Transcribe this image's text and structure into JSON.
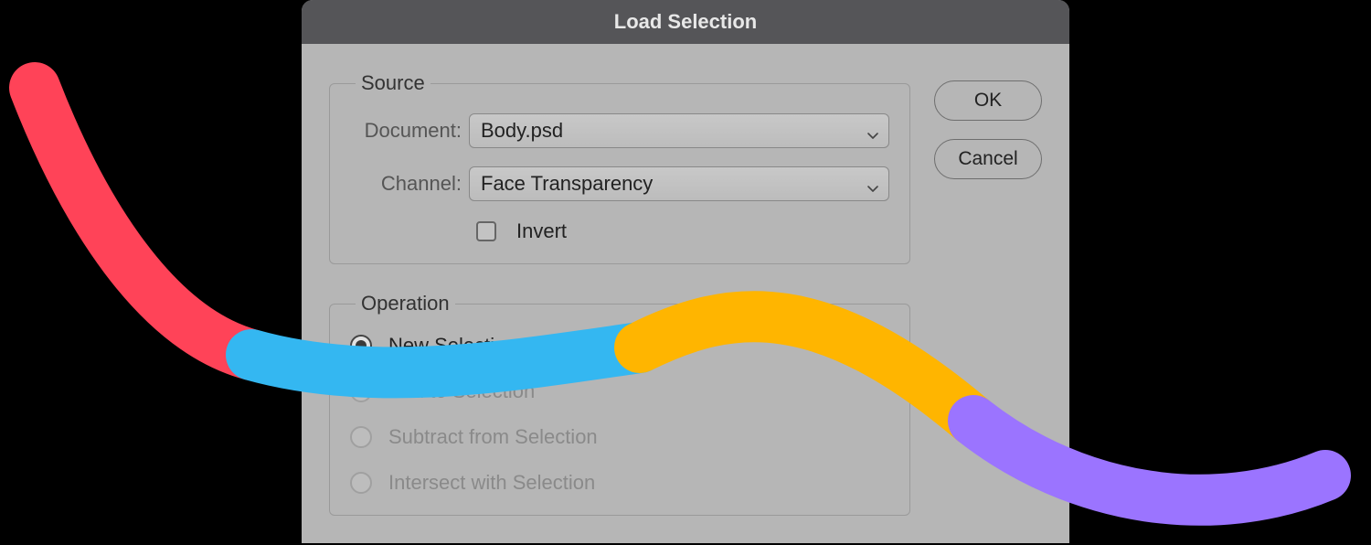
{
  "title": "Load Selection",
  "source": {
    "legend": "Source",
    "document_label": "Document:",
    "document_value": "Body.psd",
    "channel_label": "Channel:",
    "channel_value": "Face Transparency",
    "invert_label": "Invert",
    "invert_checked": false
  },
  "operation": {
    "legend": "Operation",
    "options": [
      {
        "label": "New Selection",
        "selected": true,
        "enabled": true
      },
      {
        "label": "Add to Selection",
        "selected": false,
        "enabled": false
      },
      {
        "label": "Subtract from Selection",
        "selected": false,
        "enabled": false
      },
      {
        "label": "Intersect with Selection",
        "selected": false,
        "enabled": false
      }
    ]
  },
  "buttons": {
    "ok": "OK",
    "cancel": "Cancel"
  },
  "decoration": {
    "colors": {
      "red": "#ff4358",
      "blue": "#34b7f1",
      "yellow": "#ffb500",
      "purple": "#9b74ff"
    }
  }
}
